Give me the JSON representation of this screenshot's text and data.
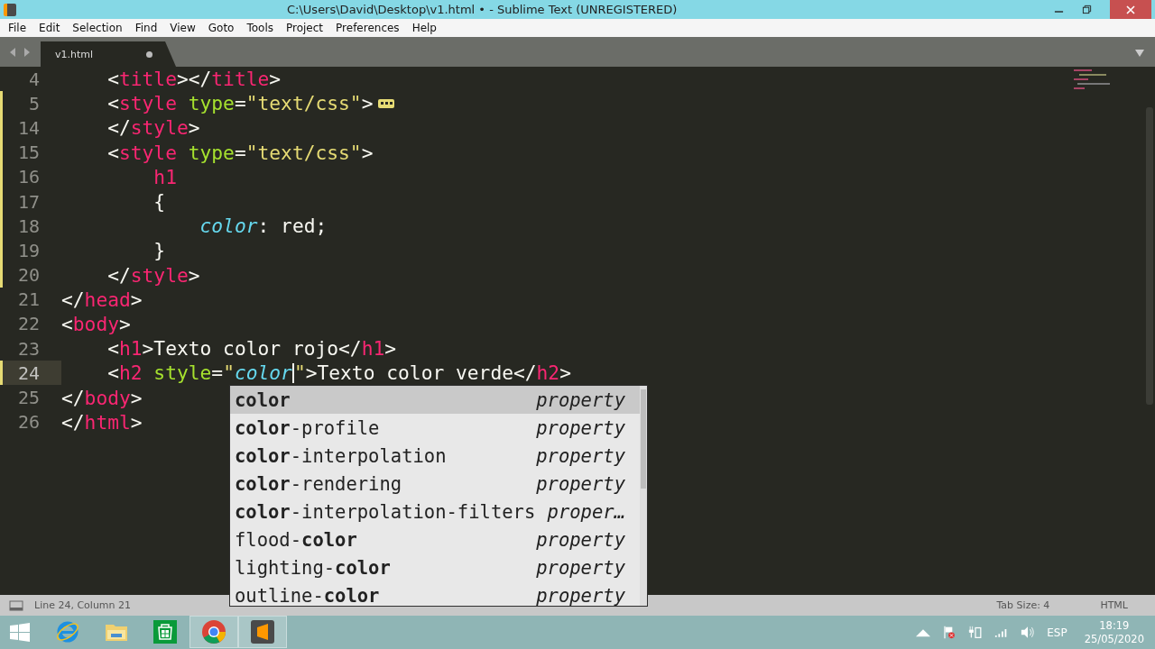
{
  "window": {
    "title": "C:\\Users\\David\\Desktop\\v1.html • - Sublime Text (UNREGISTERED)"
  },
  "menu": [
    "File",
    "Edit",
    "Selection",
    "Find",
    "View",
    "Goto",
    "Tools",
    "Project",
    "Preferences",
    "Help"
  ],
  "tabs": [
    {
      "label": "v1.html",
      "selected": true,
      "unsaved": true
    }
  ],
  "editor": {
    "lines": [
      {
        "number": "4",
        "modified": false,
        "current": false,
        "folded": false,
        "tokens": [
          {
            "kind": "punct",
            "text": "    <"
          },
          {
            "kind": "tag",
            "text": "title"
          },
          {
            "kind": "punct",
            "text": "></"
          },
          {
            "kind": "tag",
            "text": "title"
          },
          {
            "kind": "punct",
            "text": ">"
          }
        ]
      },
      {
        "number": "5",
        "modified": true,
        "current": false,
        "folded": true,
        "tokens": [
          {
            "kind": "punct",
            "text": "    <"
          },
          {
            "kind": "tag",
            "text": "style"
          },
          {
            "kind": "attr",
            "text": " type"
          },
          {
            "kind": "punct",
            "text": "="
          },
          {
            "kind": "string",
            "text": "\"text/css\""
          },
          {
            "kind": "punct",
            "text": ">"
          }
        ]
      },
      {
        "number": "14",
        "modified": true,
        "current": false,
        "folded": false,
        "tokens": [
          {
            "kind": "punct",
            "text": "    </"
          },
          {
            "kind": "tag",
            "text": "style"
          },
          {
            "kind": "punct",
            "text": ">"
          }
        ]
      },
      {
        "number": "15",
        "modified": true,
        "current": false,
        "folded": false,
        "tokens": [
          {
            "kind": "punct",
            "text": "    <"
          },
          {
            "kind": "tag",
            "text": "style"
          },
          {
            "kind": "attr",
            "text": " type"
          },
          {
            "kind": "punct",
            "text": "="
          },
          {
            "kind": "string",
            "text": "\"text/css\""
          },
          {
            "kind": "punct",
            "text": ">"
          }
        ]
      },
      {
        "number": "16",
        "modified": true,
        "current": false,
        "folded": false,
        "tokens": [
          {
            "kind": "tag",
            "text": "        h1"
          }
        ]
      },
      {
        "number": "17",
        "modified": true,
        "current": false,
        "folded": false,
        "tokens": [
          {
            "kind": "punct",
            "text": "        {"
          }
        ]
      },
      {
        "number": "18",
        "modified": true,
        "current": false,
        "folded": false,
        "tokens": [
          {
            "kind": "prop",
            "text": "            color"
          },
          {
            "kind": "punct",
            "text": ": "
          },
          {
            "kind": "text",
            "text": "red"
          },
          {
            "kind": "punct",
            "text": ";"
          }
        ]
      },
      {
        "number": "19",
        "modified": true,
        "current": false,
        "folded": false,
        "tokens": [
          {
            "kind": "punct",
            "text": "        }"
          }
        ]
      },
      {
        "number": "20",
        "modified": true,
        "current": false,
        "folded": false,
        "tokens": [
          {
            "kind": "punct",
            "text": "    </"
          },
          {
            "kind": "tag",
            "text": "style"
          },
          {
            "kind": "punct",
            "text": ">"
          }
        ]
      },
      {
        "number": "21",
        "modified": false,
        "current": false,
        "folded": false,
        "tokens": [
          {
            "kind": "punct",
            "text": "</"
          },
          {
            "kind": "tag",
            "text": "head"
          },
          {
            "kind": "punct",
            "text": ">"
          }
        ]
      },
      {
        "number": "22",
        "modified": false,
        "current": false,
        "folded": false,
        "tokens": [
          {
            "kind": "punct",
            "text": "<"
          },
          {
            "kind": "tag",
            "text": "body"
          },
          {
            "kind": "punct",
            "text": ">"
          }
        ]
      },
      {
        "number": "23",
        "modified": false,
        "current": false,
        "folded": false,
        "tokens": [
          {
            "kind": "punct",
            "text": "    <"
          },
          {
            "kind": "tag",
            "text": "h1"
          },
          {
            "kind": "punct",
            "text": ">"
          },
          {
            "kind": "text",
            "text": "Texto color rojo"
          },
          {
            "kind": "punct",
            "text": "</"
          },
          {
            "kind": "tag",
            "text": "h1"
          },
          {
            "kind": "punct",
            "text": ">"
          }
        ]
      },
      {
        "number": "24",
        "modified": true,
        "current": true,
        "folded": false,
        "tokens": [
          {
            "kind": "punct",
            "text": "    <"
          },
          {
            "kind": "tag",
            "text": "h2"
          },
          {
            "kind": "attr",
            "text": " style"
          },
          {
            "kind": "punct",
            "text": "="
          },
          {
            "kind": "string",
            "text": "\""
          },
          {
            "kind": "prop",
            "text": "color",
            "caret": true
          },
          {
            "kind": "string",
            "text": "\""
          },
          {
            "kind": "punct",
            "text": ">"
          },
          {
            "kind": "text",
            "text": "Texto color verde"
          },
          {
            "kind": "punct",
            "text": "</"
          },
          {
            "kind": "tag",
            "text": "h2"
          },
          {
            "kind": "punct",
            "text": ">"
          }
        ]
      },
      {
        "number": "25",
        "modified": false,
        "current": false,
        "folded": false,
        "tokens": [
          {
            "kind": "punct",
            "text": "</"
          },
          {
            "kind": "tag",
            "text": "body"
          },
          {
            "kind": "punct",
            "text": ">"
          }
        ]
      },
      {
        "number": "26",
        "modified": false,
        "current": false,
        "folded": false,
        "tokens": [
          {
            "kind": "punct",
            "text": "</"
          },
          {
            "kind": "tag",
            "text": "html"
          },
          {
            "kind": "punct",
            "text": ">"
          }
        ]
      }
    ]
  },
  "autocomplete": [
    {
      "label": "**color**",
      "type": "property",
      "selected": true
    },
    {
      "label": "**color**-profile",
      "type": "property",
      "selected": false
    },
    {
      "label": "**color**-interpolation",
      "type": "property",
      "selected": false
    },
    {
      "label": "**color**-rendering",
      "type": "property",
      "selected": false
    },
    {
      "label": "**color**-interpolation-filters",
      "type": "proper…",
      "selected": false
    },
    {
      "label": "flood-**color**",
      "type": "property",
      "selected": false
    },
    {
      "label": "lighting-**color**",
      "type": "property",
      "selected": false
    },
    {
      "label": "outline-**color**",
      "type": "property",
      "selected": false
    }
  ],
  "status_bar": {
    "position": "Line 24, Column 21",
    "tab_size": "Tab Size: 4",
    "syntax": "HTML"
  },
  "taskbar": {
    "apps": [
      {
        "kind": "ie",
        "active": false
      },
      {
        "kind": "folder",
        "active": false
      },
      {
        "kind": "store",
        "active": false
      },
      {
        "kind": "chrome",
        "active": true
      },
      {
        "kind": "sublime",
        "active": true
      }
    ],
    "language": "ESP",
    "time": "18:19",
    "date": "25/05/2020"
  }
}
